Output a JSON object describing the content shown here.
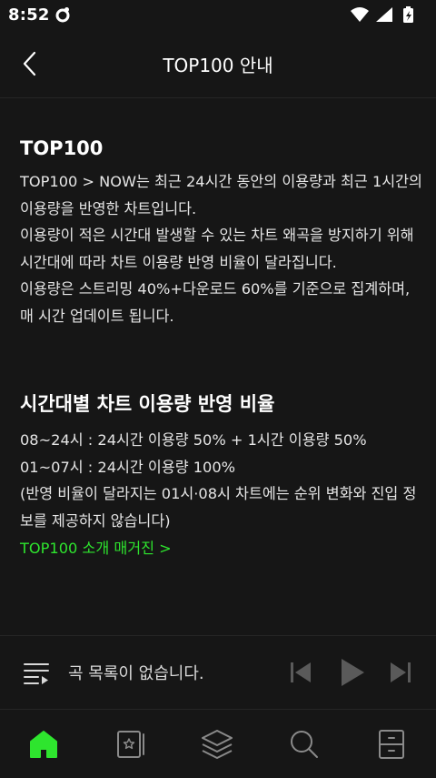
{
  "status_bar": {
    "time": "8:52",
    "icons": [
      "app-notification-icon",
      "wifi-icon",
      "cellular-signal-icon",
      "battery-charging-icon"
    ]
  },
  "header": {
    "title": "TOP100 안내",
    "back_icon": "chevron-left-icon"
  },
  "sections": [
    {
      "title": "TOP100",
      "paragraphs": [
        "TOP100 > NOW는 최근 24시간 동안의 이용량과 최근 1시간의 이용량을 반영한 차트입니다.",
        "이용량이 적은 시간대 발생할 수 있는 차트 왜곡을 방지하기 위해 시간대에 따라 차트 이용량 반영 비율이 달라집니다.",
        "이용량은 스트리밍 40%+다운로드 60%를 기준으로 집계하며, 매 시간 업데이트 됩니다."
      ]
    },
    {
      "title": "시간대별 차트 이용량 반영 비율",
      "paragraphs": [
        "08~24시 : 24시간 이용량 50% + 1시간 이용량 50%",
        "01~07시 : 24시간 이용량 100%",
        "(반영 비율이 달라지는 01시·08시 차트에는 순위 변화와 진입 정보를 제공하지 않습니다)"
      ]
    }
  ],
  "magazine_link": "TOP100 소개 매거진 >",
  "mini_player": {
    "message": "곡 목록이 없습니다.",
    "icons": [
      "playlist-icon",
      "previous-track-icon",
      "play-icon",
      "next-track-icon"
    ]
  },
  "bottom_nav": {
    "active": "home",
    "items": [
      "home-icon",
      "library-icon",
      "layers-icon",
      "search-icon",
      "drawer-icon"
    ]
  },
  "colors": {
    "background": "#161616",
    "accent": "#2ee52e",
    "text": "#ffffff",
    "muted_icon": "#8a8a8a",
    "divider": "#262626"
  }
}
